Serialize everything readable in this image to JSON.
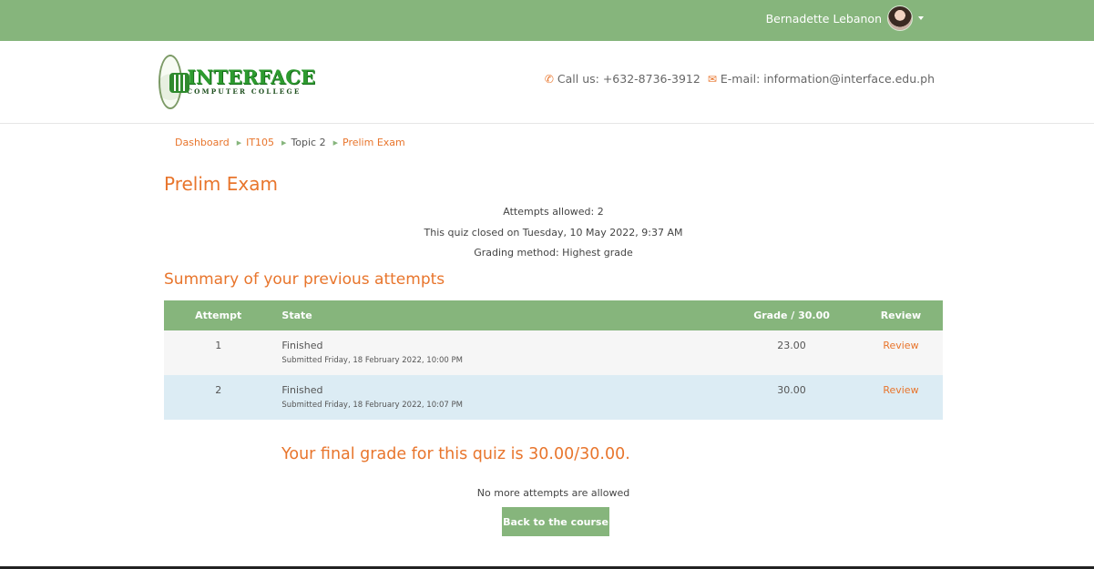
{
  "topbar": {
    "user_name": "Bernadette Lebanon",
    "avatar_icon": "user-avatar",
    "caret_icon": "caret-down-icon",
    "color": "#86b57c"
  },
  "header": {
    "logo_text": "INTERFACE",
    "logo_subtext": "COMPUTER COLLEGE",
    "phone_icon": "phone-icon",
    "phone_text": "Call us: +632-8736-3912",
    "email_icon": "envelope-icon",
    "email_text": "E-mail: information@interface.edu.ph"
  },
  "breadcrumb": {
    "items": [
      "Dashboard",
      "IT105",
      "Topic 2",
      "Prelim Exam"
    ],
    "separator_icon": "triangle-right-icon"
  },
  "quiz": {
    "title": "Prelim Exam",
    "attempts_allowed": "Attempts allowed: 2",
    "closed_info": "This quiz closed on Tuesday, 10 May 2022, 9:37 AM",
    "grading_method": "Grading method: Highest grade"
  },
  "summary": {
    "title": "Summary of your previous attempts",
    "headers": [
      "Attempt",
      "State",
      "Grade / 30.00",
      "Review"
    ],
    "rows": [
      {
        "attempt": "1",
        "state": "Finished",
        "submitted": "Submitted Friday, 18 February 2022, 10:00 PM",
        "grade": "23.00",
        "review": "Review"
      },
      {
        "attempt": "2",
        "state": "Finished",
        "submitted": "Submitted Friday, 18 February 2022, 10:07 PM",
        "grade": "30.00",
        "review": "Review"
      }
    ]
  },
  "final": {
    "grade_text": "Your final grade for this quiz is 30.00/30.00.",
    "no_more_attempts": "No more attempts are allowed",
    "back_button": "Back to the course"
  },
  "colors": {
    "accent": "#e8752c",
    "brand_green": "#86b57c",
    "row_highlight": "#dcecf4"
  }
}
